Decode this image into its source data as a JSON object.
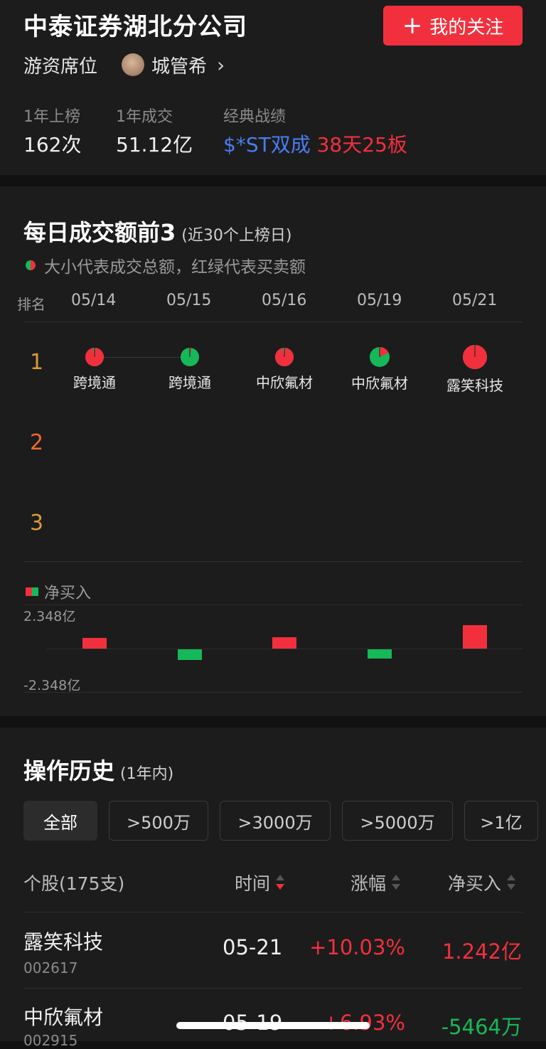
{
  "header": {
    "title": "中泰证券湖北分公司",
    "follow_label": "我的关注",
    "category": "游资席位",
    "trader_name": "城管希"
  },
  "stats": [
    {
      "label": "1年上榜",
      "value": "162次"
    },
    {
      "label": "1年成交",
      "value": "51.12亿"
    }
  ],
  "classic": {
    "label": "经典战绩",
    "stock": "$*ST双成",
    "record": "38天25板"
  },
  "daily_top": {
    "title": "每日成交额前3",
    "subtitle": "(近30个上榜日)",
    "legend_note": "大小代表成交总额，红绿代表买卖额",
    "rank_header": "排名",
    "dates": [
      "05/14",
      "05/15",
      "05/16",
      "05/19",
      "05/21"
    ],
    "ranks": [
      "1",
      "2",
      "3"
    ],
    "rank1": [
      {
        "name": "跨境通",
        "buy_share": 0.97
      },
      {
        "name": "跨境通",
        "buy_share": 0.03
      },
      {
        "name": "中欣氟材",
        "buy_share": 0.97
      },
      {
        "name": "中欣氟材",
        "buy_share": 0.18
      },
      {
        "name": "露笑科技",
        "buy_share": 0.99
      }
    ],
    "net_label": "净买入",
    "axis_max": "2.348亿",
    "axis_min": "-2.348亿"
  },
  "chart_data": {
    "type": "bar",
    "categories": [
      "05/14",
      "05/15",
      "05/16",
      "05/19",
      "05/21"
    ],
    "values": [
      0.55,
      -0.55,
      0.6,
      -0.5,
      1.242
    ],
    "ylabel": "净买入",
    "ylim": [
      -2.348,
      2.348
    ],
    "colors": {
      "positive": "#f2303d",
      "negative": "#16b85a"
    }
  },
  "history": {
    "title": "操作历史",
    "subtitle": "(1年内)",
    "filters": [
      "全部",
      ">500万",
      ">3000万",
      ">5000万",
      ">1亿"
    ],
    "columns": {
      "stock": "个股(175支)",
      "time": "时间",
      "change": "涨幅",
      "net": "净买入"
    },
    "rows": [
      {
        "name": "露笑科技",
        "code": "002617",
        "time": "05-21",
        "change": "+10.03%",
        "net": "1.242亿"
      },
      {
        "name": "中欣氟材",
        "code": "002915",
        "time": "05-19",
        "change": "+6.93%",
        "net": "-5464万"
      }
    ]
  },
  "colors": {
    "accent": "#f2303d",
    "buy": "#f2303d",
    "sell": "#16b85a",
    "link": "#4a7cf2"
  }
}
